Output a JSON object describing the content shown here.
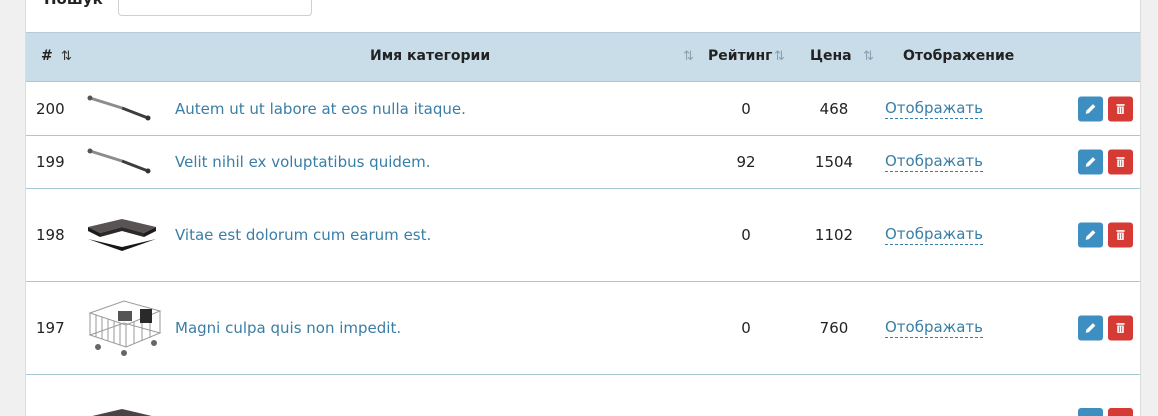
{
  "search": {
    "label": "Пошук",
    "value": ""
  },
  "table": {
    "headers": {
      "id": "#",
      "name": "Имя категории",
      "rating": "Рейтинг",
      "price": "Цена",
      "display": "Отображение"
    },
    "rows": [
      {
        "id": "200",
        "name": "Autem ut ut labore at eos nulla itaque.",
        "rating": "0",
        "price": "468",
        "display": "Отображать",
        "image": "gas-strut"
      },
      {
        "id": "199",
        "name": "Velit nihil ex voluptatibus quidem.",
        "rating": "92",
        "price": "1504",
        "display": "Отображать",
        "image": "gas-strut"
      },
      {
        "id": "198",
        "name": "Vitae est dolorum cum earum est.",
        "rating": "0",
        "price": "1102",
        "display": "Отображать",
        "image": "corner-worktop"
      },
      {
        "id": "197",
        "name": "Magni culpa quis non impedit.",
        "rating": "0",
        "price": "760",
        "display": "Отображать",
        "image": "dish-rack"
      }
    ]
  },
  "colors": {
    "header_bg": "#c8dde8",
    "link": "#3a7ea6",
    "edit_button": "#3d8fc2",
    "delete_button": "#d63a34"
  },
  "icons": {
    "edit": "pencil-icon",
    "delete": "trash-icon",
    "sort": "sort-arrows-icon"
  }
}
